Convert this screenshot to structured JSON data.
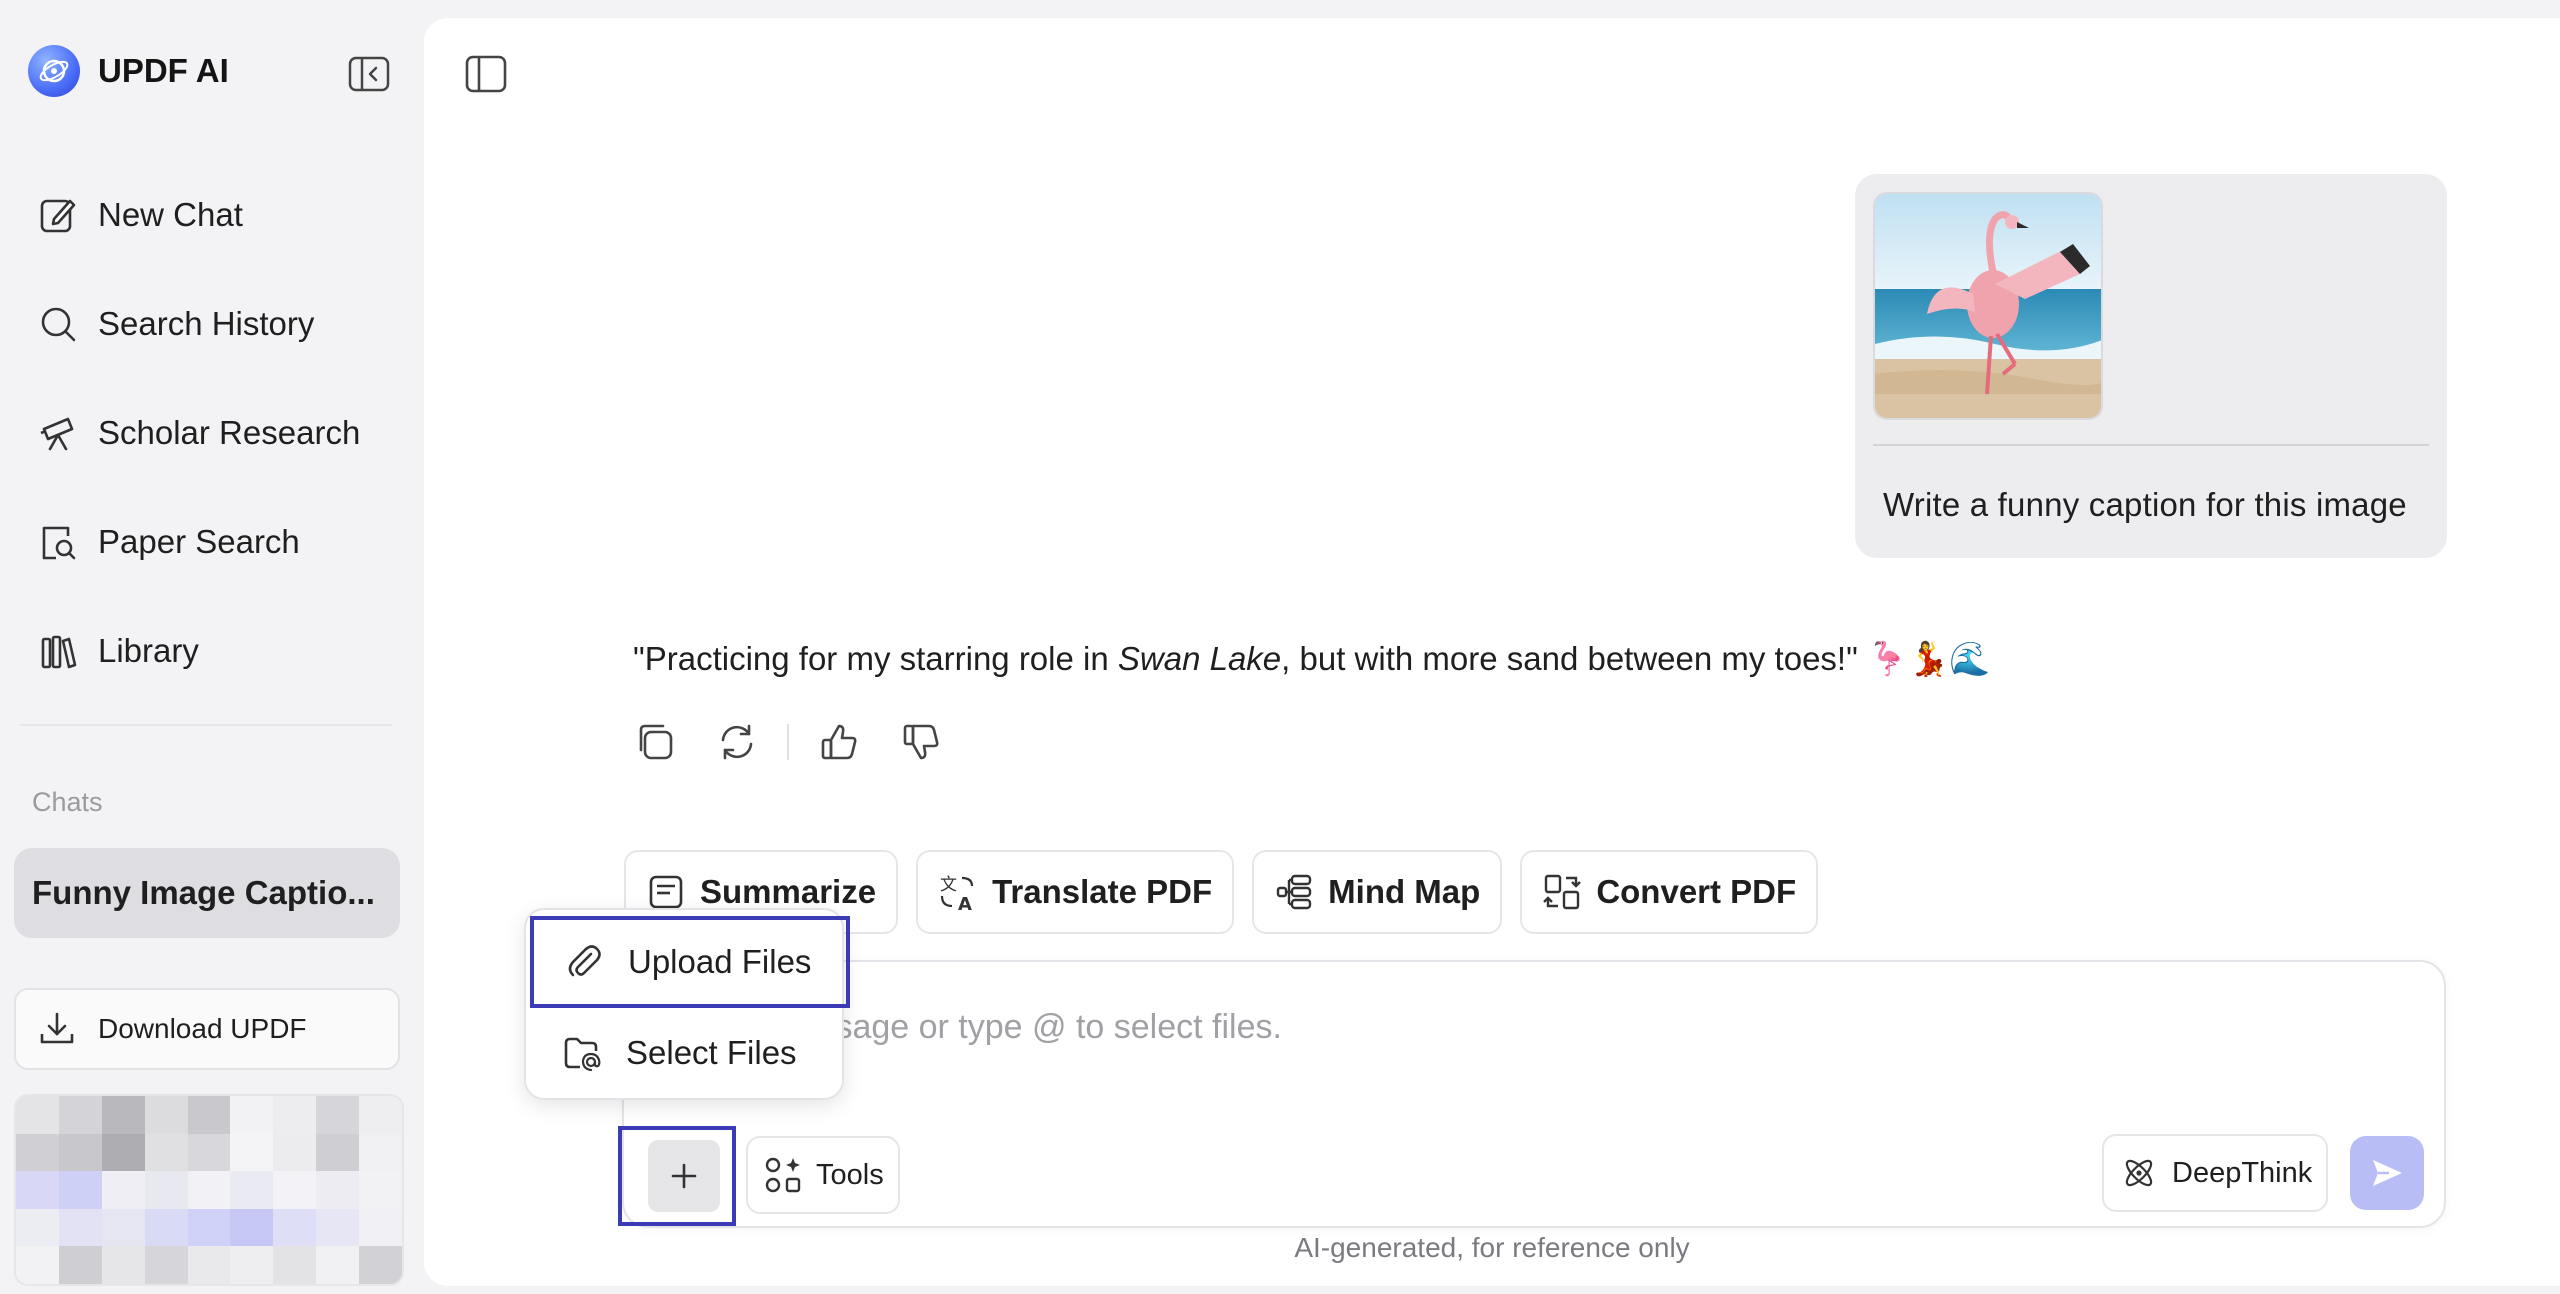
{
  "app": {
    "name": "UPDF AI"
  },
  "sidebar": {
    "nav": [
      {
        "label": "New Chat",
        "icon": "new-chat-icon"
      },
      {
        "label": "Search History",
        "icon": "search-icon"
      },
      {
        "label": "Scholar Research",
        "icon": "telescope-icon"
      },
      {
        "label": "Paper Search",
        "icon": "paper-search-icon"
      },
      {
        "label": "Library",
        "icon": "library-icon"
      }
    ],
    "chats_heading": "Chats",
    "active_chat": "Funny Image Captio...",
    "download_label": "Download UPDF"
  },
  "conversation": {
    "user_message": "Write a funny caption for this image",
    "image_alt": "flamingo-on-beach",
    "ai_reply": {
      "before": "\"Practicing for my starring role in ",
      "italic": "Swan Lake",
      "after": ", but with more sand between my toes!\" 🦩💃🌊"
    }
  },
  "quick_tools": [
    {
      "label": "Summarize",
      "icon": "summarize-icon"
    },
    {
      "label": "Translate PDF",
      "icon": "translate-icon"
    },
    {
      "label": "Mind Map",
      "icon": "mind-map-icon"
    },
    {
      "label": "Convert PDF",
      "icon": "convert-icon"
    }
  ],
  "composer": {
    "placeholder": "Send a message or type @ to select files.",
    "tools_label": "Tools",
    "deepthink_label": "DeepThink"
  },
  "attach_menu": {
    "upload_label": "Upload Files",
    "select_label": "Select Files"
  },
  "disclaimer": "AI-generated, for reference only",
  "colors": {
    "accent": "#3b3bb5",
    "send_disabled": "#b8bdf6",
    "sidebar_bg": "#f3f3f5",
    "active_chat_bg": "#dedee2"
  }
}
